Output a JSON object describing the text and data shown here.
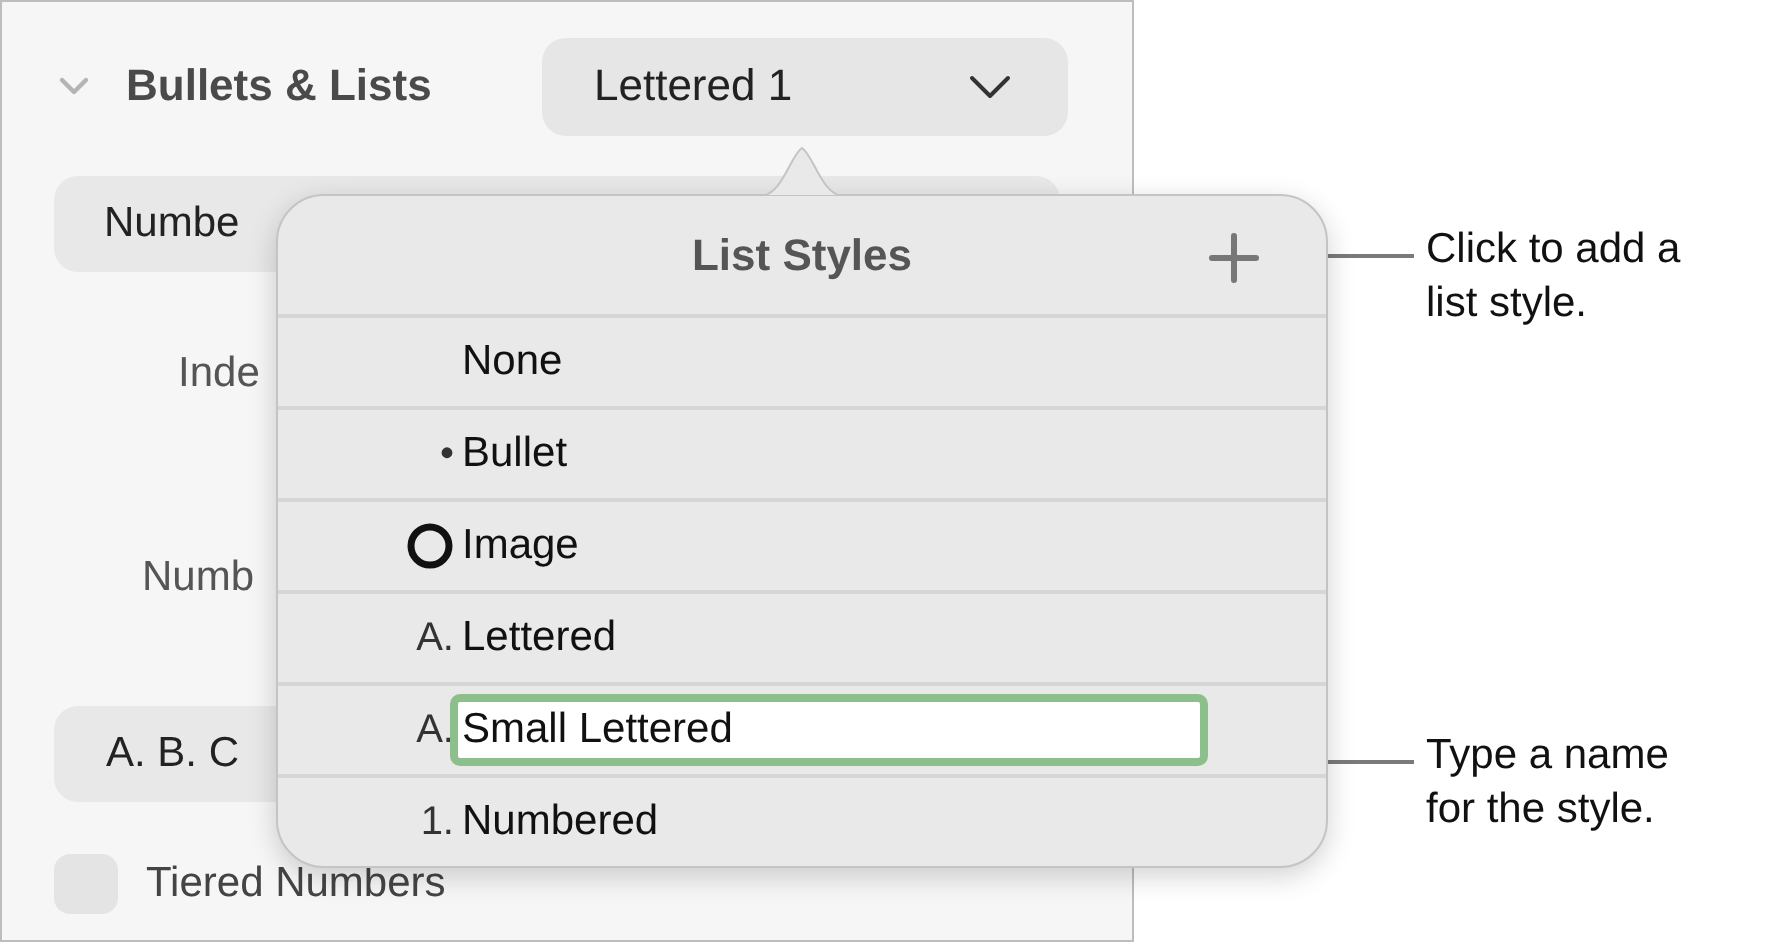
{
  "sidebar": {
    "section": {
      "title": "Bullets & Lists",
      "expanded": true
    },
    "style_dropdown": {
      "value": "Lettered 1"
    },
    "type_button": {
      "label": "Numbe"
    },
    "indent_label": "Inde",
    "number_label": "Numb",
    "format_button": {
      "label": "A. B. C"
    },
    "tiered_numbers": {
      "label": "Tiered Numbers",
      "checked": false
    }
  },
  "popover": {
    "title": "List Styles",
    "styles": [
      {
        "kind": "none",
        "name": "None",
        "editing": false
      },
      {
        "kind": "text",
        "marker": "•",
        "name": "Bullet",
        "editing": false
      },
      {
        "kind": "image",
        "name": "Image",
        "editing": false
      },
      {
        "kind": "text",
        "marker": "A.",
        "name": "Lettered",
        "editing": false
      },
      {
        "kind": "text",
        "marker": "A.",
        "name": "Small Lettered",
        "editing": true
      },
      {
        "kind": "text",
        "marker": "1.",
        "name": "Numbered",
        "editing": false
      }
    ]
  },
  "callouts": [
    {
      "text": "Click to add a list style."
    },
    {
      "text": "Type a name for the style."
    }
  ]
}
